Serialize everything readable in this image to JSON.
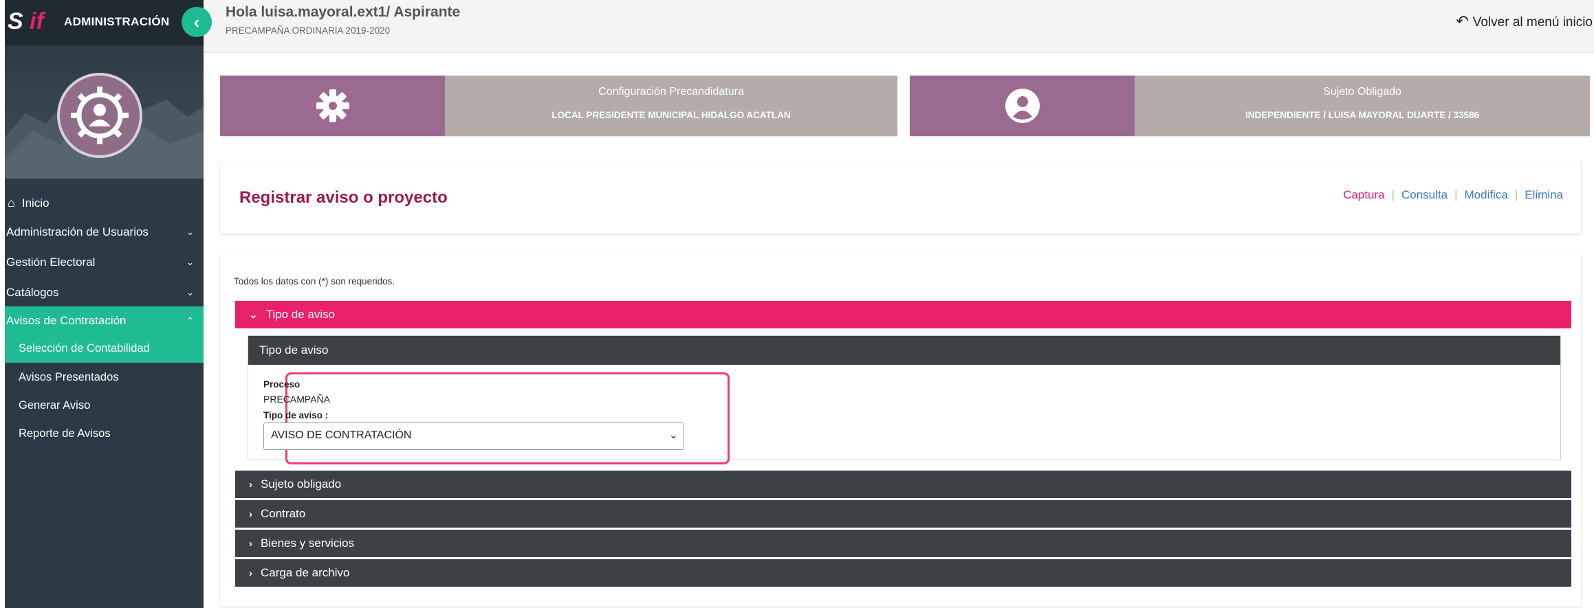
{
  "sidebar": {
    "logo_s": "S",
    "logo_if": "if",
    "title": "ADMINISTRACIÓN",
    "collapse_icon": "chevron-left-icon",
    "nav": [
      {
        "label": "Inicio",
        "icon": "home-icon"
      },
      {
        "label": "Administración de Usuarios",
        "expanded": false
      },
      {
        "label": "Gestión Electoral",
        "expanded": false
      },
      {
        "label": "Catálogos",
        "expanded": false
      },
      {
        "label": "Avisos de Contratación",
        "expanded": true
      }
    ],
    "subnav": [
      {
        "label": "Selección de Contabilidad",
        "active": true
      },
      {
        "label": "Avisos Presentados"
      },
      {
        "label": "Generar Aviso"
      },
      {
        "label": "Reporte de Avisos"
      }
    ]
  },
  "header": {
    "greeting": "Hola luisa.mayoral.ext1/ Aspirante",
    "period": "PRECAMPAÑA ORDINARIA 2019-2020",
    "back_link": "Volver al menú inicio"
  },
  "cards": {
    "config": {
      "icon": "gear-icon",
      "title": "Configuración Precandidatura",
      "value": "LOCAL PRESIDENTE MUNICIPAL HIDALGO ACATLAN"
    },
    "sujeto": {
      "icon": "user-circle-icon",
      "title": "Sujeto Obligado",
      "value": "INDEPENDIENTE / LUISA MAYORAL DUARTE / 33586"
    }
  },
  "page": {
    "title": "Registrar aviso o proyecto",
    "actions": [
      "Captura",
      "Consulta",
      "Modifica",
      "Elimina"
    ]
  },
  "form": {
    "required_note": "Todos los datos con (*) son requeridos.",
    "tipo_section": "Tipo de aviso",
    "inner_header": "Tipo de aviso",
    "proceso_label": "Proceso",
    "proceso_value": "PRECAMPAÑA",
    "tipo_label": "Tipo de aviso :",
    "tipo_value": "AVISO DE CONTRATACIÓN",
    "sections": [
      "Sujeto obligado",
      "Contrato",
      "Bienes y servicios",
      "Carga de archivo"
    ]
  },
  "colors": {
    "accent_pink": "#e9216a",
    "accent_green": "#1fbb93",
    "sidebar_bg": "#2b3a44",
    "card_purple": "#9b6a91",
    "card_gray": "#b4aca9",
    "title_color": "#9c1b4f"
  }
}
